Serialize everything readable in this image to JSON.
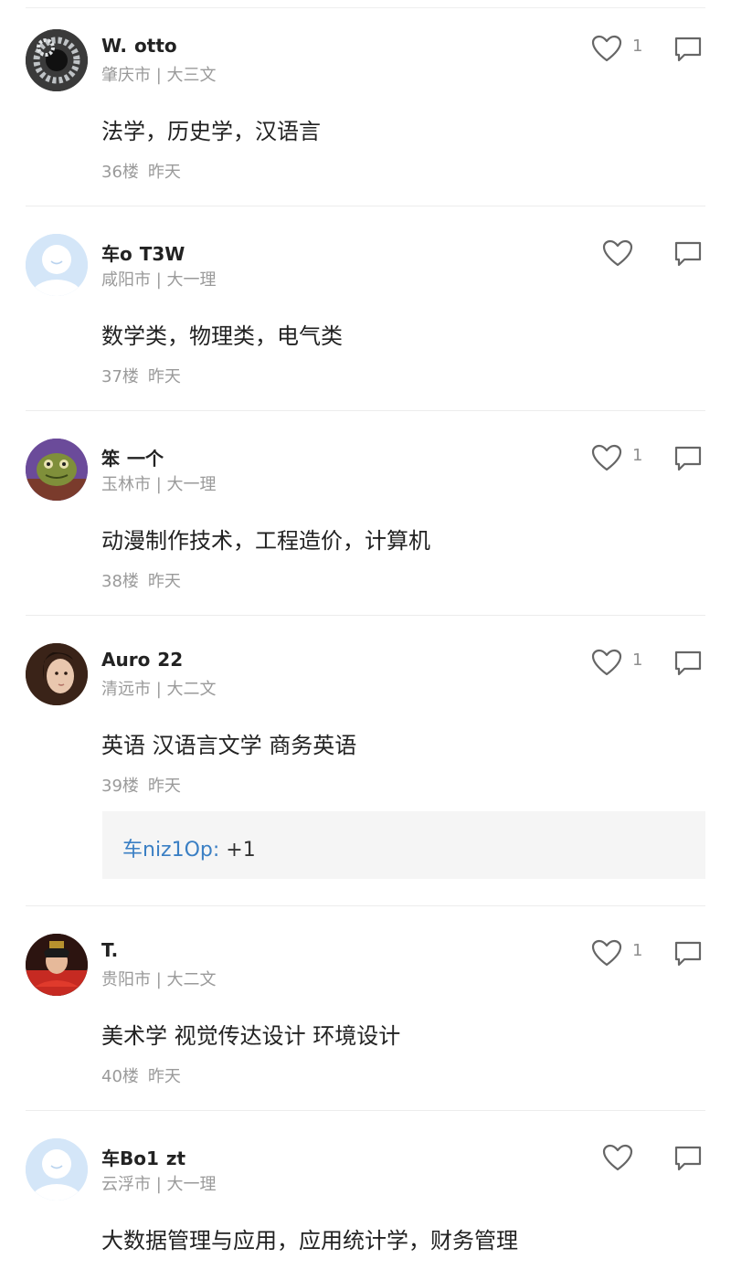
{
  "comments": [
    {
      "username": "W.  otto",
      "location": "肇庆市",
      "grade": "大三文",
      "content": "法学，历史学，汉语言",
      "floor": "36楼",
      "time": "昨天",
      "likes": "1",
      "avatar": "chain-rings"
    },
    {
      "username": "车o  T3W",
      "location": "咸阳市",
      "grade": "大一理",
      "content": "数学类，物理类，电气类",
      "floor": "37楼",
      "time": "昨天",
      "likes": "",
      "avatar": "default"
    },
    {
      "username": "笨  一个",
      "location": "玉林市",
      "grade": "大一理",
      "content": "动漫制作技术，工程造价，计算机",
      "floor": "38楼",
      "time": "昨天",
      "likes": "1",
      "avatar": "cartoon-frog"
    },
    {
      "username": "Auro  22",
      "location": "清远市",
      "grade": "大二文",
      "content": "英语 汉语言文学 商务英语",
      "floor": "39楼",
      "time": "昨天",
      "likes": "1",
      "avatar": "portrait-woman",
      "reply": {
        "author": "车niz1Op:",
        "text": " +1"
      }
    },
    {
      "username": "T.",
      "location": "贵阳市",
      "grade": "大二文",
      "content": "美术学 视觉传达设计 环境设计",
      "floor": "40楼",
      "time": "昨天",
      "likes": "1",
      "avatar": "red-costume"
    },
    {
      "username": "车Bo1  zt",
      "location": "云浮市",
      "grade": "大一理",
      "content": "大数据管理与应用，应用统计学，财务管理",
      "floor": "",
      "time": "",
      "likes": "",
      "avatar": "default"
    }
  ],
  "separator": " | ",
  "colors": {
    "reply_author": "#3a7fc4",
    "meta": "#9a9a9a",
    "reply_bg": "#f5f5f5",
    "default_avatar": "#cfe3f7"
  }
}
